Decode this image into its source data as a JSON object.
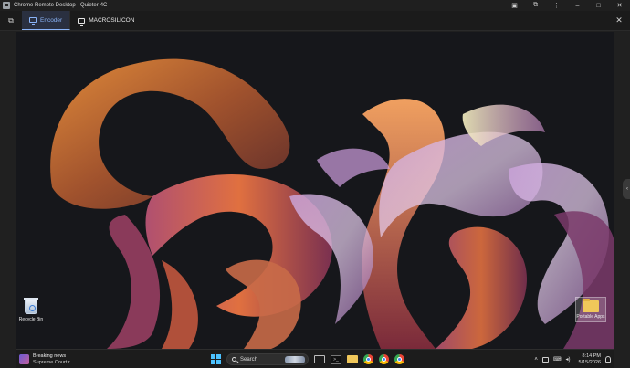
{
  "window": {
    "title": "Chrome Remote Desktop - Quieter-4C",
    "controls": [
      "restore-icon",
      "extension-icon",
      "more-icon",
      "minimize-icon",
      "maximize-icon",
      "close-icon"
    ]
  },
  "tabbar": {
    "tabs": [
      {
        "label": "Encoder",
        "active": true
      },
      {
        "label": "MACROSILICON",
        "active": false
      }
    ]
  },
  "desktop": {
    "icons": [
      {
        "label": "Recycle Bin"
      },
      {
        "label": "Portable Apps"
      }
    ]
  },
  "taskbar": {
    "news_title": "Breaking news",
    "news_subtitle": "Supreme Court r...",
    "search_placeholder": "Search",
    "time": "8:14 PM",
    "date": "5/15/2026"
  },
  "colors": {
    "accent": "#8ab4f8",
    "windows_blue": "#4cc2ff"
  }
}
